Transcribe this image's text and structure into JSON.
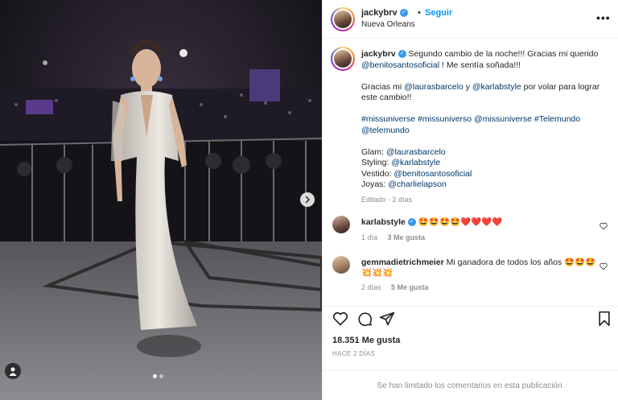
{
  "post": {
    "username": "jackybrv",
    "follow_label": "Seguir",
    "separator": "•",
    "location": "Nueva Orleans",
    "more_label": "•••"
  },
  "caption": {
    "username": "jackybrv",
    "line1": " Segundo cambio de la noche!!! Gracias mi querido ",
    "mention_benito": "@benitosantosoficial",
    "line1_end": " ! Me sentía soñada!!!",
    "p2_start": "Gracias mi ",
    "mention_laura": "@laurasbarcelo",
    "p2_mid": " y ",
    "mention_karla": "@karlabstyle",
    "p2_end": " por volar para lograr este cambio!!",
    "hashtags": "#missuniverse #missuniverso @missuniverse #Telemundo @telemundo",
    "glam_label": "Glam: ",
    "glam_value": "@laurasbarcelo",
    "styling_label": "Styling: ",
    "styling_value": "@karlabstyle",
    "vestido_label": "Vestido: ",
    "vestido_value": "@benitosantosoficial",
    "joyas_label": "Joyas: ",
    "joyas_value": "@charlielapson",
    "edited_meta": "Editado · 2 días"
  },
  "comments": [
    {
      "username": "karlabstyle",
      "text": "🤩🤩🤩🤩❤️❤️❤️❤️",
      "time": "1 día",
      "likes": "3 Me gusta"
    },
    {
      "username": "gemmadietrichmeier",
      "text": "Mi ganadora de todos los años 🤩🤩🤩💥💥💥",
      "time": "2 días",
      "likes": "5 Me gusta"
    }
  ],
  "footer": {
    "likes_count": "18.351 Me gusta",
    "date": "HACE 2 DÍAS",
    "comments_limited": "Se han limitado los comentarios en esta publicación."
  },
  "icons": {
    "like": "heart-icon",
    "comment": "comment-icon",
    "share": "send-icon",
    "save": "bookmark-icon",
    "next": "chevron-right-icon",
    "user_tags": "user-icon"
  },
  "colors": {
    "link": "#00376b",
    "follow": "#0095f6",
    "muted": "#8e8e8e",
    "text": "#262626"
  }
}
